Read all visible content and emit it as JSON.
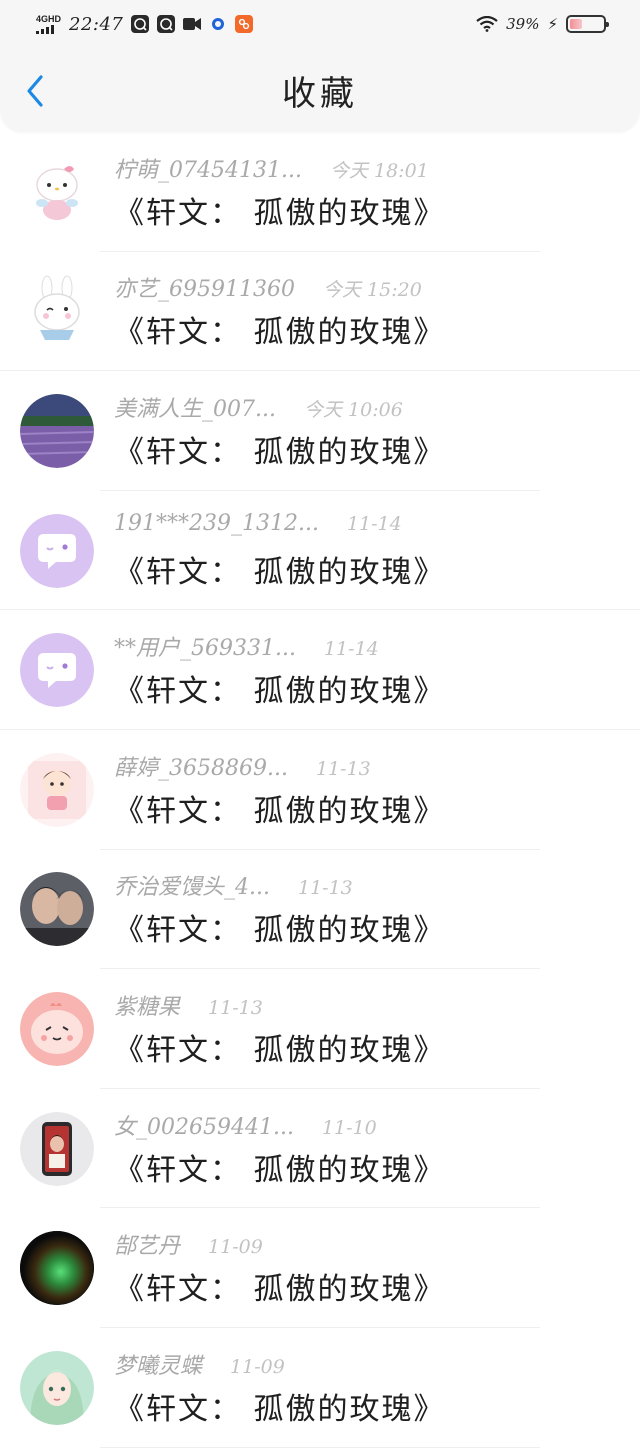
{
  "status_bar": {
    "network": "4GHD",
    "time": "22:47",
    "battery_percent": "39%",
    "battery_level": 0.39,
    "icons": [
      "signal-icon",
      "app-notification-icon",
      "app-notification-icon",
      "video-icon",
      "blue-ring-app-icon",
      "orange-app-icon",
      "wifi-icon",
      "charging-bolt-icon",
      "battery-icon"
    ]
  },
  "header": {
    "title": "收藏",
    "back_icon": "chevron-left-icon",
    "accent_color": "#1e88e5"
  },
  "items": [
    {
      "name": "柠萌_07454131...",
      "time": "今天 18:01",
      "title": "《轩文： 孤傲的玫瑰》",
      "avatar": "hello-kitty-avatar"
    },
    {
      "name": "亦艺_695911360",
      "time": "今天 15:20",
      "title": "《轩文： 孤傲的玫瑰》",
      "avatar": "bunny-avatar"
    },
    {
      "name": "美满人生_007...",
      "time": "今天 10:06",
      "title": "《轩文： 孤傲的玫瑰》",
      "avatar": "lavender-field-avatar"
    },
    {
      "name": "191***239_1312...",
      "time": "11-14",
      "title": "《轩文： 孤傲的玫瑰》",
      "avatar": "default-chat-avatar"
    },
    {
      "name": "**用户_569331...",
      "time": "11-14",
      "title": "《轩文： 孤傲的玫瑰》",
      "avatar": "default-chat-avatar"
    },
    {
      "name": "薛婷_3658869...",
      "time": "11-13",
      "title": "《轩文： 孤傲的玫瑰》",
      "avatar": "cartoon-boy-avatar"
    },
    {
      "name": "乔治爱馒头_4...",
      "time": "11-13",
      "title": "《轩文： 孤傲的玫瑰》",
      "avatar": "photo-couple-avatar"
    },
    {
      "name": "紫糖果",
      "time": "11-13",
      "title": "《轩文： 孤傲的玫瑰》",
      "avatar": "pink-blob-avatar"
    },
    {
      "name": "女_002659441...",
      "time": "11-10",
      "title": "《轩文： 孤傲的玫瑰》",
      "avatar": "phone-photo-avatar"
    },
    {
      "name": "郜艺丹",
      "time": "11-09",
      "title": "《轩文： 孤傲的玫瑰》",
      "avatar": "green-glow-avatar"
    },
    {
      "name": "梦曦灵蝶",
      "time": "11-09",
      "title": "《轩文： 孤傲的玫瑰》",
      "avatar": "anime-girl-avatar"
    }
  ]
}
